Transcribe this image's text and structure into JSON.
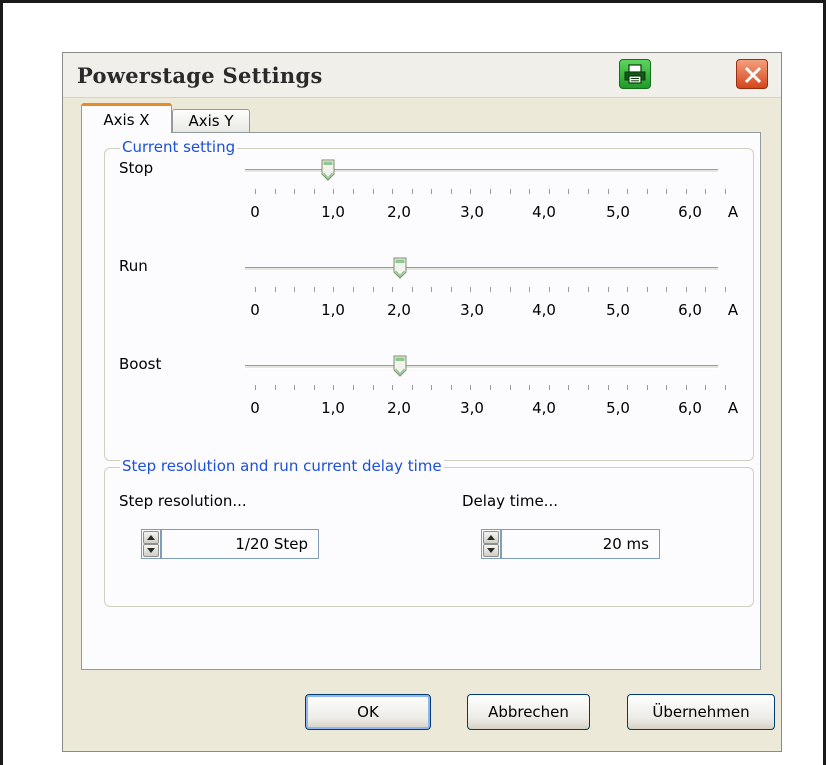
{
  "window": {
    "title": "Powerstage Settings"
  },
  "tabs": [
    {
      "label": "Axis X",
      "active": true
    },
    {
      "label": "Axis Y",
      "active": false
    }
  ],
  "current_setting": {
    "legend": "Current setting",
    "scale": [
      "0",
      "1,0",
      "2,0",
      "3,0",
      "4,0",
      "5,0",
      "6,0"
    ],
    "unit": "A",
    "sliders": [
      {
        "label": "Stop",
        "value": 1.0
      },
      {
        "label": "Run",
        "value": 2.0
      },
      {
        "label": "Boost",
        "value": 2.0
      }
    ]
  },
  "step_group": {
    "legend": "Step resolution and run current delay time",
    "step_resolution": {
      "label": "Step resolution...",
      "value": "1/20  Step"
    },
    "delay_time": {
      "label": "Delay time...",
      "value": "20 ms"
    }
  },
  "buttons": {
    "ok": "OK",
    "cancel": "Abbrechen",
    "apply": "Übernehmen"
  },
  "colors": {
    "legend_text": "#1c50d8",
    "active_tab_accent": "#e68b2c",
    "print_icon": "#2bb33a",
    "close_icon": "#d2461c"
  }
}
